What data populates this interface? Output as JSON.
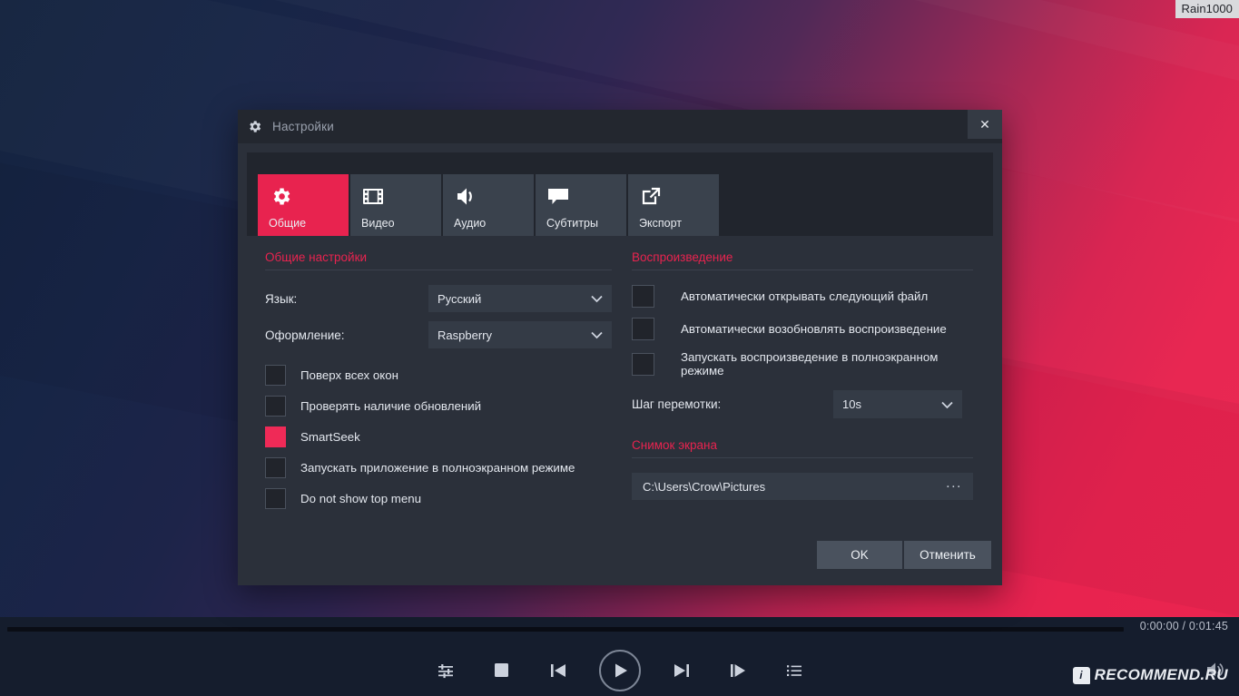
{
  "watermarks": {
    "user_chip": "Rain1000",
    "site": "RECOMMEND.RU",
    "site_badge": "i"
  },
  "dialog": {
    "title": "Настройки",
    "title_icon": "gear-icon",
    "close_icon": "✕",
    "tabs": [
      {
        "label": "Общие",
        "icon": "gear-icon",
        "active": true
      },
      {
        "label": "Видео",
        "icon": "film-strip-icon",
        "active": false
      },
      {
        "label": "Аудио",
        "icon": "speaker-icon",
        "active": false
      },
      {
        "label": "Субтитры",
        "icon": "speech-bubble-icon",
        "active": false
      },
      {
        "label": "Экспорт",
        "icon": "external-link-icon",
        "active": false
      }
    ],
    "general": {
      "section_title": "Общие настройки",
      "language": {
        "label": "Язык:",
        "value": "Русский"
      },
      "theme": {
        "label": "Оформление:",
        "value": "Raspberry"
      },
      "checkboxes": [
        {
          "label": "Поверх всех окон",
          "checked": false
        },
        {
          "label": "Проверять наличие обновлений",
          "checked": false
        },
        {
          "label": "SmartSeek",
          "checked": true
        },
        {
          "label": "Запускать приложение в полноэкранном режиме",
          "checked": false
        },
        {
          "label": "Do not show top menu",
          "checked": false
        }
      ]
    },
    "playback": {
      "section_title": "Воспроизведение",
      "checkboxes": [
        {
          "label": "Автоматически открывать следующий файл",
          "checked": false
        },
        {
          "label": "Автоматически возобновлять воспроизведение",
          "checked": false
        },
        {
          "label": "Запускать воспроизведение в полноэкранном режиме",
          "checked": false
        }
      ],
      "seek_step": {
        "label": "Шаг перемотки:",
        "value": "10s"
      }
    },
    "screenshot": {
      "section_title": "Снимок экрана",
      "path": "C:\\Users\\Crow\\Pictures",
      "browse_label": "..."
    },
    "footer": {
      "ok": "OK",
      "cancel": "Отменить"
    }
  },
  "player": {
    "timecode": "0:00:00 / 0:01:45",
    "progress_percent": 0,
    "controls": [
      {
        "name": "equalizer-button",
        "icon": "sliders-icon"
      },
      {
        "name": "stop-button",
        "icon": "stop-icon"
      },
      {
        "name": "previous-button",
        "icon": "skip-previous-icon"
      },
      {
        "name": "play-button",
        "icon": "play-icon"
      },
      {
        "name": "next-button",
        "icon": "skip-next-icon"
      },
      {
        "name": "step-forward-button",
        "icon": "step-forward-icon"
      },
      {
        "name": "playlist-button",
        "icon": "list-icon"
      }
    ]
  },
  "colors": {
    "accent": "#e8234f",
    "dialog_bg": "#2b303a",
    "titlebar_bg": "#23272f",
    "tabstrip_bg": "#21252d",
    "tab_bg": "#3a424d",
    "field_bg": "#343b46",
    "player_bg": "#151d2d",
    "text": "#e3e7ee"
  }
}
